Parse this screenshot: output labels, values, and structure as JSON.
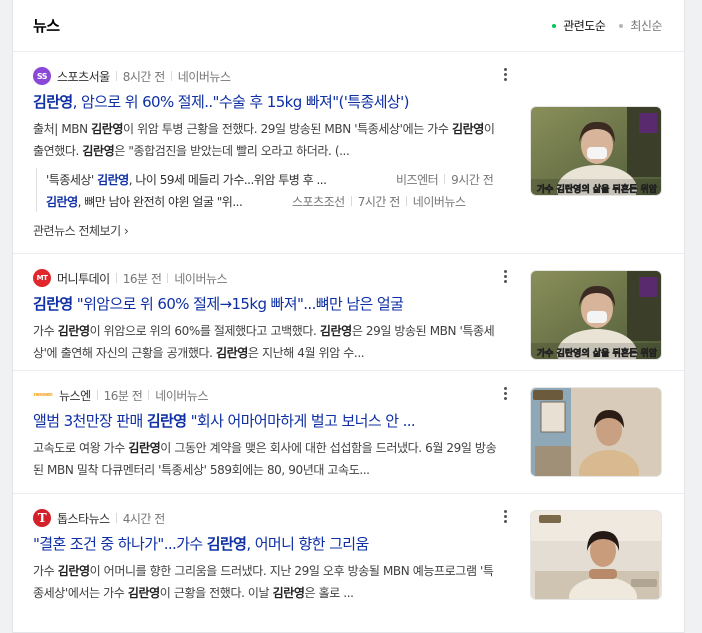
{
  "header": {
    "title": "뉴스",
    "sort_related": "관련도순",
    "sort_latest": "최신순",
    "accent": "#03c75a"
  },
  "articles": [
    {
      "press": "스포츠서울",
      "logo_text": "SS",
      "logo_color": "#9a3fd6",
      "time": "8시간 전",
      "source": "네이버뉴스",
      "title_prefix": "",
      "title_highlight": "김란영",
      "title_suffix": ", 암으로 위 60% 절제..\"수술 후 15kg 빠져\"('특종세상')",
      "desc_a": "출처| MBN ",
      "desc_b": "김란영",
      "desc_c": "이 위암 투병 근황을 전했다. 29일 방송된 MBN '특종세상'에는 가수 ",
      "desc_d": "김란영",
      "desc_e": "이 출연했다. ",
      "desc_f": "김란영",
      "desc_g": "은 \"종합검진을 받았는데 빨리 오라고 하더라. (...",
      "thumb_caption": "가수 김란영의 삶을 뒤흔든 위암",
      "sub": [
        {
          "pre": "'특종세상' ",
          "hl": "김란영",
          "post": ", 나이 59세 메들리 가수...위암 투병 후 ...",
          "press": "비즈엔터",
          "time": "9시간 전"
        },
        {
          "pre": "",
          "hl": "김란영",
          "post": ", 뼈만 남아 완전히 야윈 얼굴 \"위...",
          "press": "스포츠조선",
          "time": "7시간 전",
          "source": "네이버뉴스"
        }
      ],
      "all_news": "관련뉴스 전체보기 ›"
    },
    {
      "press": "머니투데이",
      "logo_text": "MT",
      "logo_color": "#e0272c",
      "time": "16분 전",
      "source": "네이버뉴스",
      "title_prefix": "",
      "title_highlight": "김란영",
      "title_suffix": " \"위암으로 위 60% 절제→15kg 빠져\"...뼈만 남은 얼굴",
      "desc_a": "가수 ",
      "desc_b": "김란영",
      "desc_c": "이 위암으로 위의 60%를 절제했다고 고백했다. ",
      "desc_d": "김란영",
      "desc_e": "은 29일 방송된 MBN '특종세상'에 출연해 자신의 근황을 공개했다. ",
      "desc_f": "김란영",
      "desc_g": "은 지난해 4월 위암 수...",
      "thumb_caption": "가수 김란영의 삶을 뒤흔든 위암"
    },
    {
      "press": "뉴스엔",
      "logo_text": "newsen",
      "logo_color": "#f5a623",
      "time": "16분 전",
      "source": "네이버뉴스",
      "title_prefix": "앨범 3천만장 판매 ",
      "title_highlight": "김란영",
      "title_suffix": " \"회사 어마어마하게 벌고 보너스 안 ...",
      "desc_a": "고속도로 여왕 가수 ",
      "desc_b": "김란영",
      "desc_c": "이 그동안 계약을 맺은 회사에 대한 섭섭함을 드러냈다. 6월 29일 방송된 MBN 밀착 다큐멘터리 '특종세상' 589회에는 80, 90년대 고속도...",
      "desc_d": "",
      "desc_e": "",
      "desc_f": "",
      "desc_g": "",
      "thumb_caption": ""
    },
    {
      "press": "톱스타뉴스",
      "logo_text": "T",
      "logo_color": "#d4202a",
      "time": "4시간 전",
      "source": "",
      "title_prefix": "\"결혼 조건 중 하나가\"...가수 ",
      "title_highlight": "김란영",
      "title_suffix": ", 어머니 향한 그리움",
      "desc_a": "가수 ",
      "desc_b": "김란영",
      "desc_c": "이 어머니를 향한 그리움을 드러냈다. 지난 29일 오후 방송될 MBN 예능프로그램 '특종세상'에서는 가수 ",
      "desc_d": "김란영",
      "desc_e": "이 근황을 전했다. 이날 ",
      "desc_f": "김란영",
      "desc_g": "은 홀로 ...",
      "thumb_caption": ""
    }
  ]
}
